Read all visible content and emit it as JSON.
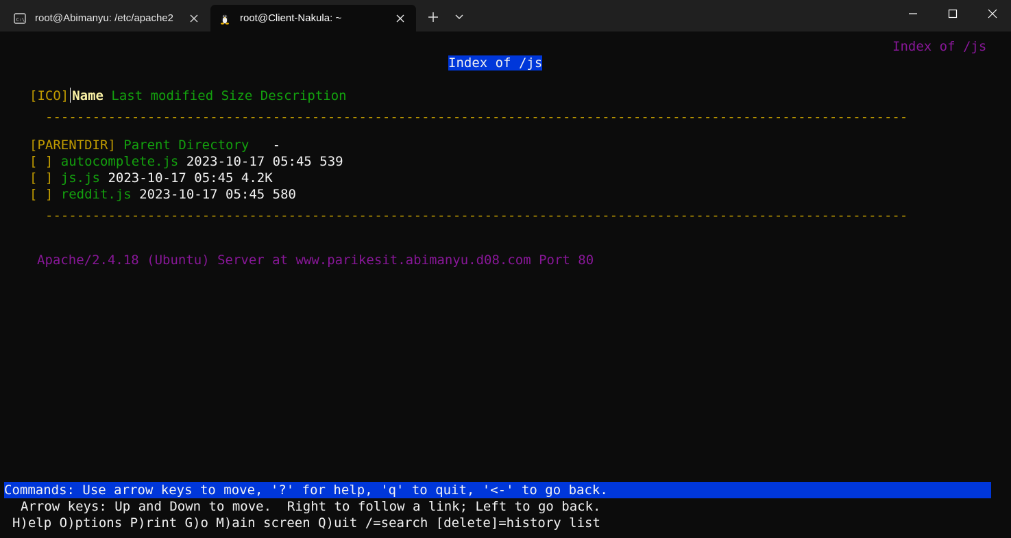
{
  "tabs": [
    {
      "label": "root@Abimanyu: /etc/apache2",
      "icon": "command-prompt-icon",
      "active": false
    },
    {
      "label": "root@Client-Nakula: ~",
      "icon": "linux-penguin-icon",
      "active": true
    }
  ],
  "terminal": {
    "top_right_title": "Index of /js",
    "heading": "Index of /js",
    "columns": {
      "ico": "[ICO]",
      "name": "Name",
      "rest": "Last modified Size Description"
    },
    "rule": "--------------------------------------------------------------------------------------------------------------",
    "parent": {
      "tag": "[PARENTDIR]",
      "name": "Parent Directory",
      "dash": "-"
    },
    "files": [
      {
        "tag": "[ ]",
        "name": "autocomplete.js",
        "meta": "2023-10-17 05:45 539"
      },
      {
        "tag": "[ ]",
        "name": "js.js",
        "meta": "2023-10-17 05:45 4.2K"
      },
      {
        "tag": "[ ]",
        "name": "reddit.js",
        "meta": "2023-10-17 05:45 580"
      }
    ],
    "server_line": "Apache/2.4.18 (Ubuntu) Server at www.parikesit.abimanyu.d08.com Port 80",
    "status_line": "Commands: Use arrow keys to move, '?' for help, 'q' to quit, '<-' to go back.",
    "help_line_1": "Arrow keys: Up and Down to move.  Right to follow a link; Left to go back.",
    "help_line_2": "H)elp O)ptions P)rint G)o M)ain screen Q)uit /=search [delete]=history list"
  },
  "colors": {
    "background": "#0c0c0c",
    "titlebar": "#202020",
    "purple": "#881798",
    "gold": "#c19c00",
    "green": "#13a10e",
    "highlight": "#0037da"
  }
}
